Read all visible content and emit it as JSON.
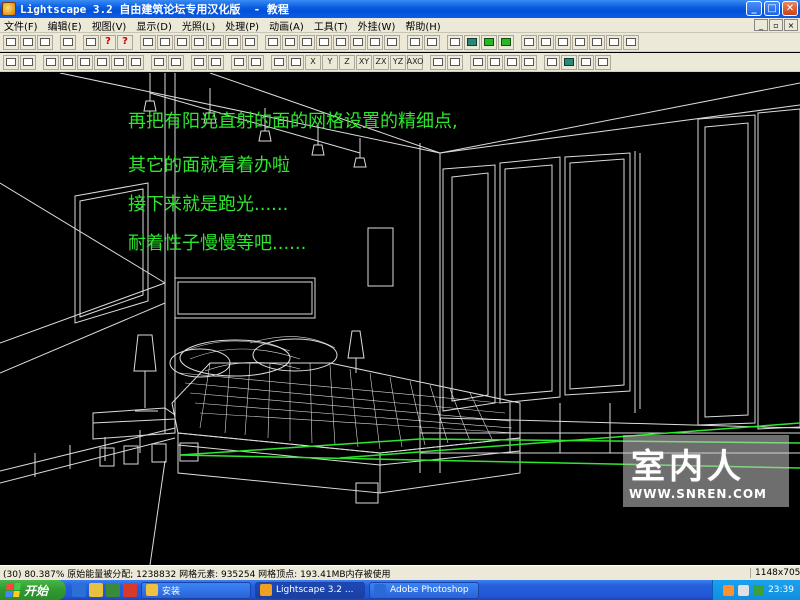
{
  "window": {
    "title": "Lightscape 3.2 自由建筑论坛专用汉化版  - 教程",
    "minimize": "_",
    "maximize": "□",
    "close": "✕"
  },
  "menu": [
    "文件(F)",
    "编辑(E)",
    "视图(V)",
    "显示(D)",
    "光照(L)",
    "处理(P)",
    "动画(A)",
    "工具(T)",
    "外挂(W)",
    "帮助(H)"
  ],
  "mdi_buttons": [
    "_",
    "▫",
    "×"
  ],
  "toolbar2_labels": [
    "X",
    "Y",
    "Z",
    "XY",
    "ZX",
    "YZ",
    "AXO"
  ],
  "overlay_lines": [
    "再把有阳光直射的面的网格设置的精细点,",
    "其它的面就看着办啦",
    "接下来就是跑光......",
    "耐着性子慢慢等吧......"
  ],
  "overlay_color": "#2ee62e",
  "watermark": {
    "cn": "室内人",
    "url": "WWW.SNREN.COM"
  },
  "status": {
    "main": "(30) 80.387% 原始能量被分配; 1238832 网格元素: 935254 网格顶点: 193.41MB内存被使用",
    "resolution": "1148x705"
  },
  "taskbar": {
    "start": "开始",
    "tasks": [
      {
        "label": "安装",
        "icon_color": "#f0c040"
      },
      {
        "label": "Lightscape 3.2 ...",
        "icon_color": "#f0a020"
      },
      {
        "label": "Adobe Photoshop",
        "icon_color": "#2a6ad8"
      }
    ],
    "clock": "23:39"
  }
}
